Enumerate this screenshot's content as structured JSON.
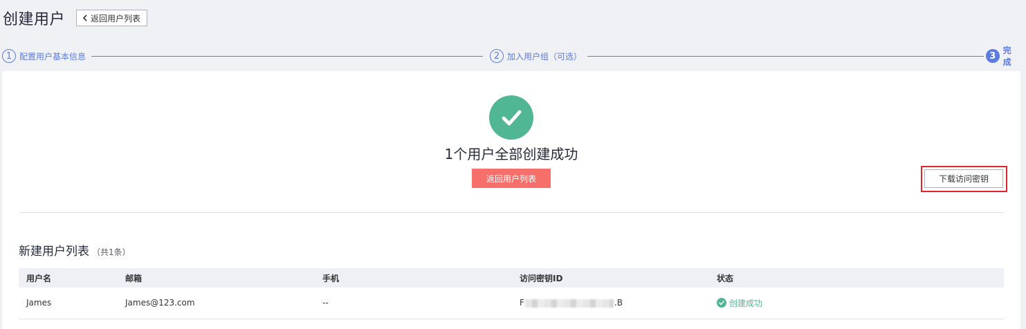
{
  "header": {
    "title": "创建用户",
    "back_label": "返回用户列表"
  },
  "steps": [
    {
      "number": "1",
      "label": "配置用户基本信息"
    },
    {
      "number": "2",
      "label": "加入用户组（可选）"
    },
    {
      "number": "3",
      "label": "完成"
    }
  ],
  "result": {
    "message": "1个用户全部创建成功",
    "back_button_label": "返回用户列表"
  },
  "user_list": {
    "title": "新建用户列表",
    "count_label": "（共1条）",
    "download_button_label": "下载访问密钥",
    "columns": [
      "用户名",
      "邮箱",
      "手机",
      "访问密钥ID",
      "状态"
    ],
    "rows": [
      {
        "username": "James",
        "email": "James@123.com",
        "phone": "--",
        "access_key_prefix": "F",
        "access_key_suffix": ".B",
        "status": "创建成功"
      }
    ]
  },
  "colors": {
    "accent": "#5e7ce0",
    "success": "#50b694",
    "primary_button": "#f66f6a",
    "highlight_box": "#e32229"
  },
  "icons": {
    "back": "chevron-left-icon",
    "success": "check-circle-icon",
    "status": "check-circle-icon"
  }
}
